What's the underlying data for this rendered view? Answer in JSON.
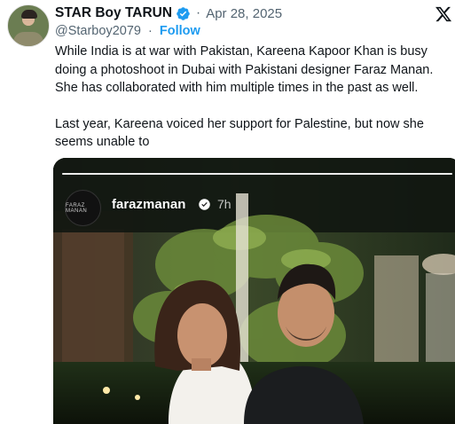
{
  "author": {
    "display_name": "STAR Boy TARUN",
    "separator": "·",
    "date": "Apr 28, 2025",
    "handle": "@Starboy2079",
    "follow_label": "Follow"
  },
  "icons": {
    "verified": "verified-badge-icon",
    "platform": "x-logo-icon"
  },
  "colors": {
    "accent": "#1d9bf0",
    "text": "#0f1419",
    "muted": "#536471"
  },
  "tweet": {
    "paragraph_1": "While India is at war with Pakistan, Kareena Kapoor Khan is busy doing a photoshoot in Dubai with Pakistani designer Faraz Manan. She has collaborated with him multiple times in the past as well.",
    "paragraph_2": "Last year, Kareena voiced her support for Palestine, but now she seems unable to"
  },
  "media": {
    "story_username": "farazmanan",
    "story_time": "7h",
    "story_avatar_text": "FARAZ MANAN"
  }
}
